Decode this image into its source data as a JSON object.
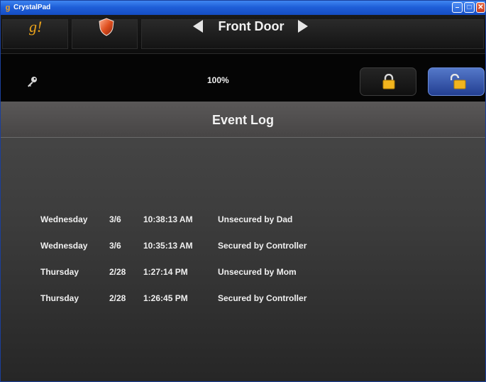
{
  "window": {
    "title": "CrystalPad",
    "icon": "crystalpad-app-icon"
  },
  "nav": {
    "logo_text": "g!",
    "shield_icon": "shield-icon",
    "door_title": "Front Door",
    "prev_icon": "left-arrow-icon",
    "next_icon": "right-arrow-icon"
  },
  "status": {
    "key_icon": "key-icon",
    "battery_percent": "100%",
    "lock_state": "unlocked"
  },
  "event_log": {
    "title": "Event Log",
    "entries": [
      {
        "day": "Wednesday",
        "date": "3/6",
        "time": "10:38:13 AM",
        "description": "Unsecured by Dad"
      },
      {
        "day": "Wednesday",
        "date": "3/6",
        "time": "10:35:13 AM",
        "description": "Secured by Controller"
      },
      {
        "day": "Thursday",
        "date": "2/28",
        "time": "1:27:14 PM",
        "description": "Unsecured by Mom"
      },
      {
        "day": "Thursday",
        "date": "2/28",
        "time": "1:26:45 PM",
        "description": "Secured by Controller"
      }
    ]
  },
  "colors": {
    "logo": "#e9a21b",
    "lock_gold": "#f2b51e",
    "active_button": "#3a5fb5",
    "title_bar": "#1f5fd8"
  }
}
